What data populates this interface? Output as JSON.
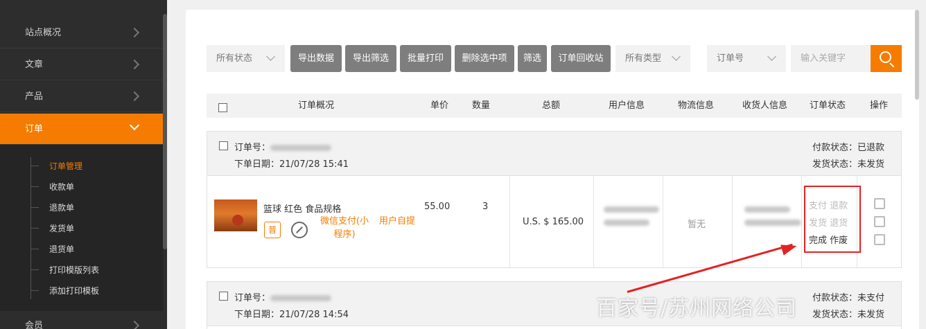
{
  "sidebar": {
    "items": [
      {
        "label": "站点概况"
      },
      {
        "label": "文章"
      },
      {
        "label": "产品"
      },
      {
        "label": "订单"
      },
      {
        "label": "会员"
      }
    ],
    "sub_items": [
      {
        "label": "订单管理"
      },
      {
        "label": "收款单"
      },
      {
        "label": "退款单"
      },
      {
        "label": "发货单"
      },
      {
        "label": "退货单"
      },
      {
        "label": "打印模版列表"
      },
      {
        "label": "添加打印模板"
      }
    ]
  },
  "toolbar": {
    "status_select": "所有状态",
    "buttons": [
      "导出数据",
      "导出筛选",
      "批量打印",
      "删除选中项",
      "筛选",
      "订单回收站"
    ],
    "type_select": "所有类型",
    "field_select": "订单号",
    "search_placeholder": "输入关键字"
  },
  "table": {
    "headers": [
      "订单概况",
      "单价",
      "数量",
      "总额",
      "用户信息",
      "物流信息",
      "收货人信息",
      "订单状态",
      "操作"
    ]
  },
  "orders": [
    {
      "no_label": "订单号：",
      "date_label": "下单日期：21/07/28 15:41",
      "pay_status": "付款状态：已退款",
      "ship_status": "发货状态：未发货",
      "product": "篮球 红色 食品规格",
      "tag": "普",
      "payment": "微信支付(小程序)",
      "source": "用户自提",
      "price": "55.00",
      "qty": "3",
      "total": "U.S. $ 165.00",
      "logistics": "暂无",
      "status_actions": {
        "row1": "支付 退款",
        "row2": "发货 退货",
        "row3": "完成 作废"
      }
    },
    {
      "no_label": "订单号：",
      "date_label": "下单日期：21/07/28 14:54",
      "pay_status": "付款状态：未支付",
      "ship_status": "发货状态：未发货"
    }
  ],
  "watermark": "百家号/苏州网络公司"
}
